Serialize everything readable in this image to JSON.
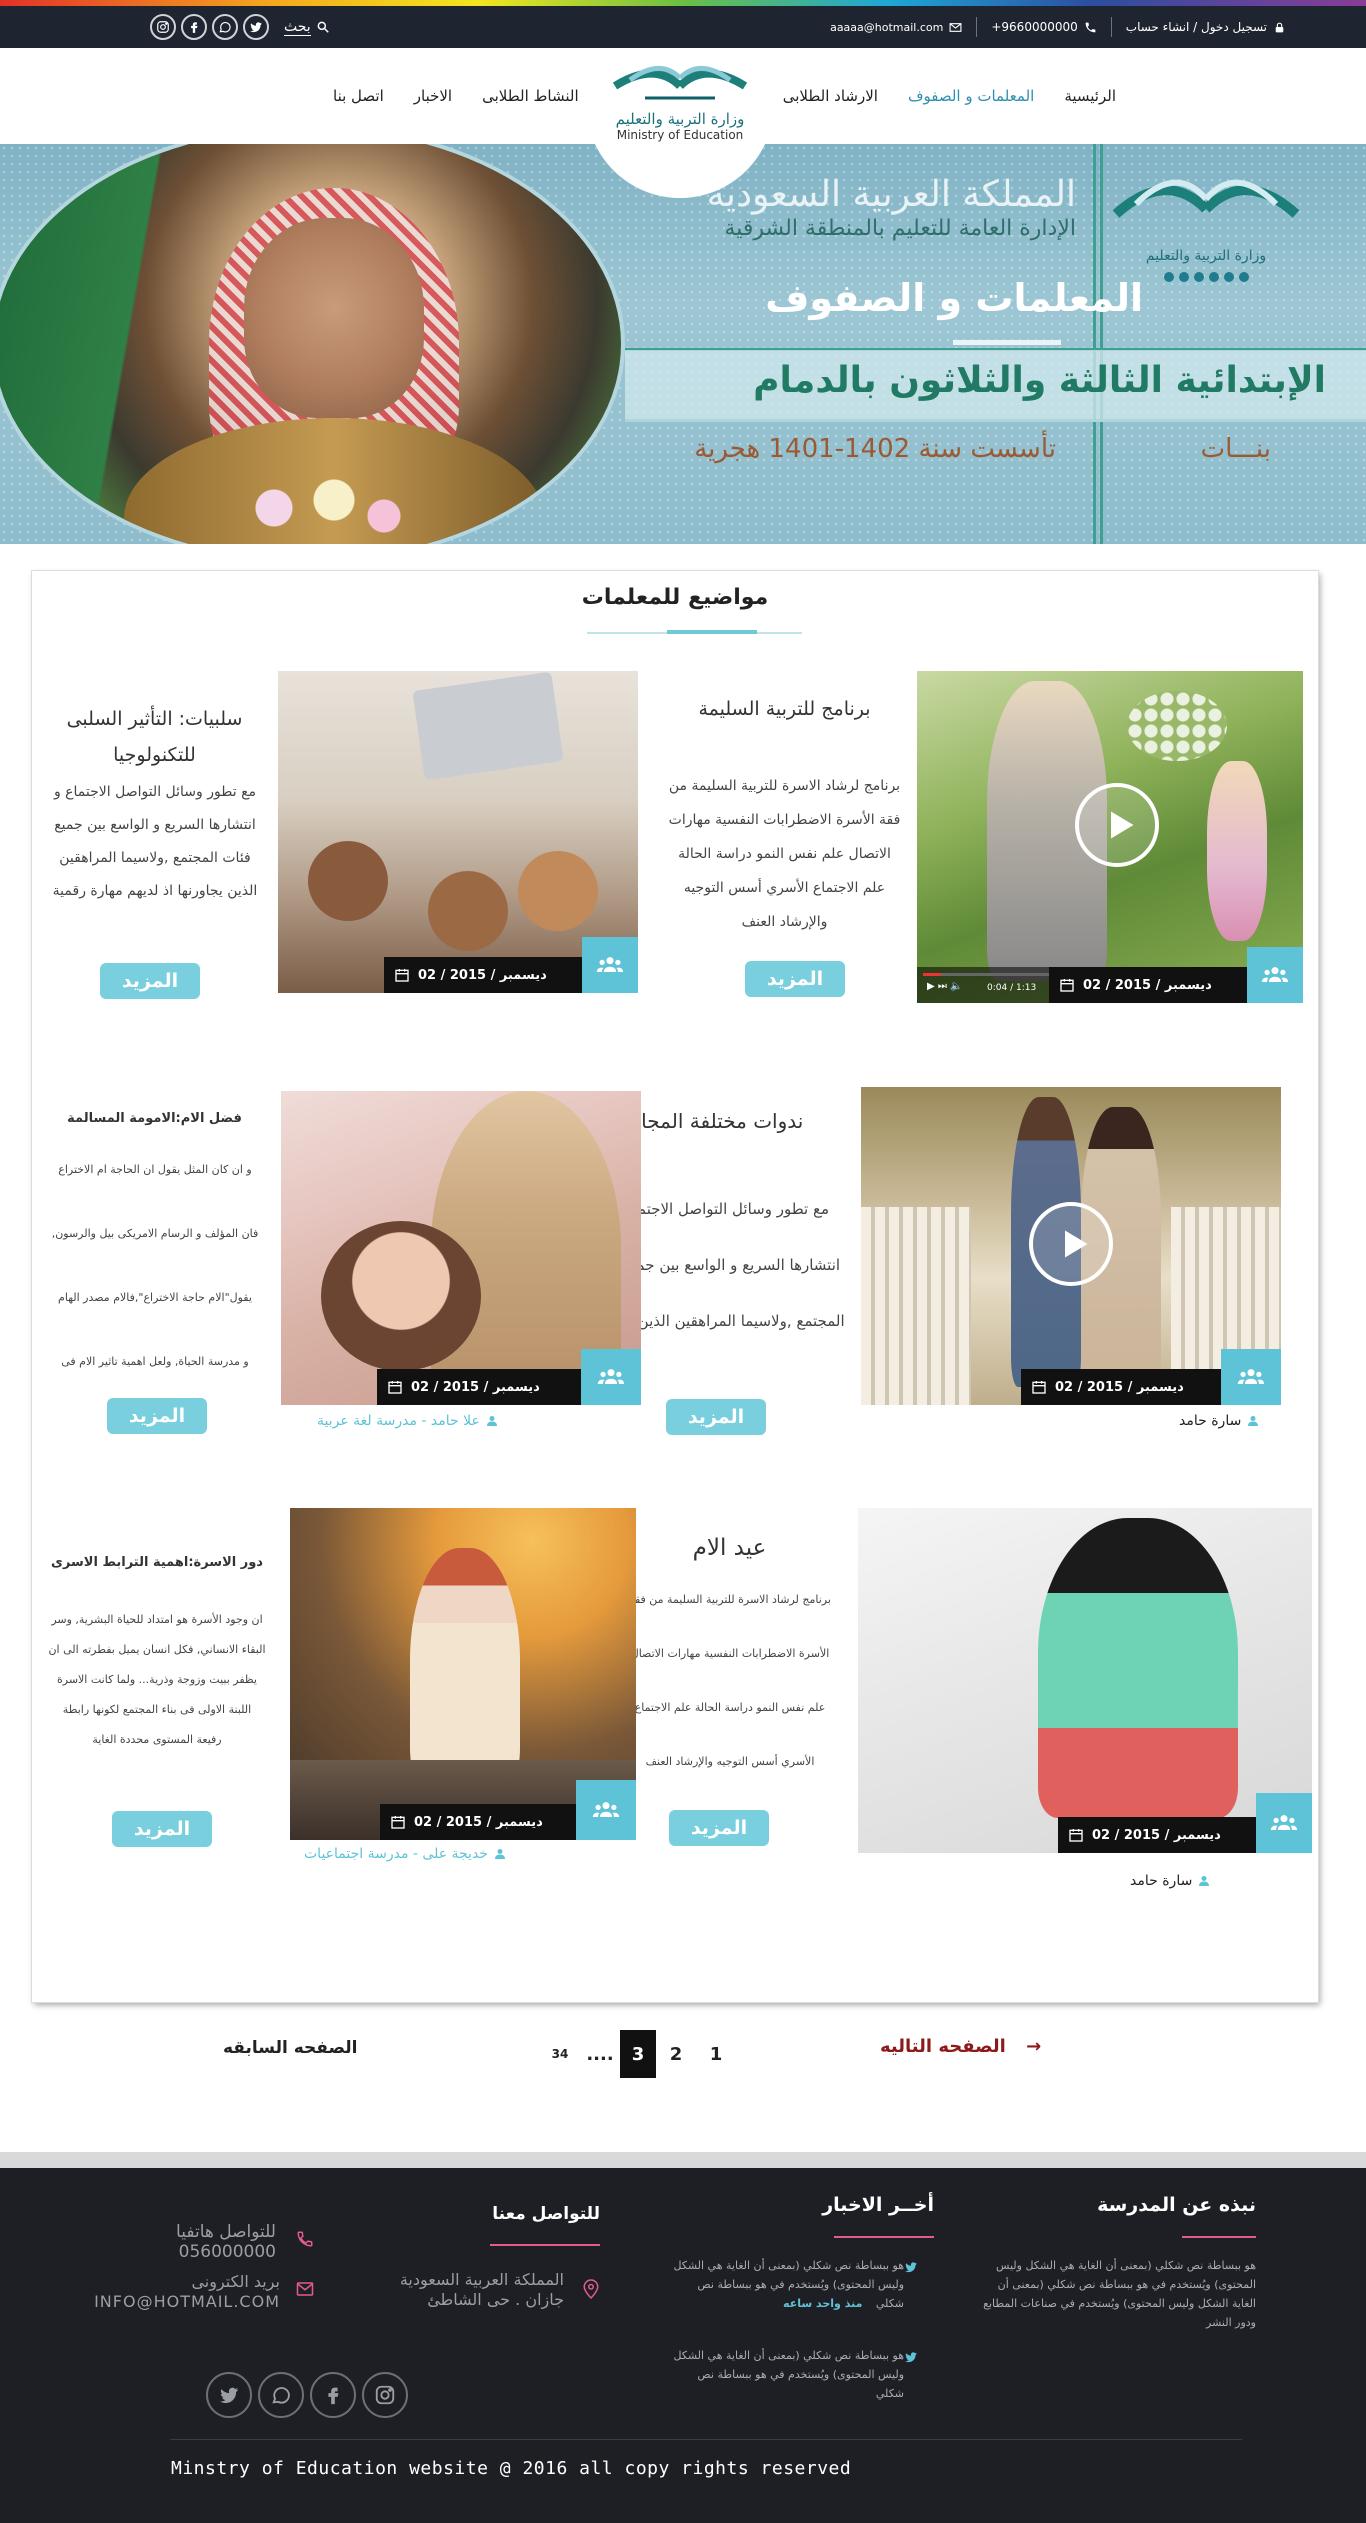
{
  "topbar": {
    "search_label": "بحث",
    "login_label": "تسجيل دخول / انشاء حساب",
    "phone": "+9660000000",
    "email": "aaaaa@hotmail.com"
  },
  "nav": {
    "items": [
      "الرئيسية",
      "المعلمات و الصفوف",
      "الارشاد الطلابى",
      "النشاط الطلابى",
      "الاخبار",
      "اتصل بنا"
    ],
    "active_index": 1,
    "logo_ar": "وزارة التربية والتعليم",
    "logo_en": "Ministry of Education"
  },
  "hero": {
    "kingdom": "المملكة العربية السعودية",
    "directorate": "الإدارة العامة للتعليم بالمنطقة الشرقية",
    "page_title": "المعلمات و الصفوف",
    "school": "الإبتدائية الثالثة والثلاثون بالدمام",
    "founded": "تأسست سنة 1402-1401 هجرية",
    "girls": "بنـــات",
    "mini_logo_ar": "وزارة التربية والتعليم"
  },
  "section": {
    "title": "مواضيع للمعلمات"
  },
  "posts": [
    {
      "date": "02 / ديسمبر / 2015",
      "title": "برنامج للتربية السليمة",
      "body": "برنامج لرشاد الاسرة للتربية السليمة من فقة الأسرة الاضطرابات النفسية مهارات الاتصال علم نفس النمو دراسة الحالة علم الاجتماع الأسري أسس التوجيه والإرشاد العنف",
      "more": "المزيد"
    },
    {
      "date": "02 / ديسمبر / 2015",
      "title": "سلبيات: التأثير السلبى للتكنولوجيا",
      "body": "مع تطور وسائل التواصل الاجتماع و انتشارها السريع و الواسع بين جميع فئات المجتمع ,ولاسيما المراهقين الذين يجاورنها اذ لديهم مهارة رقمية",
      "more": "المزيد"
    },
    {
      "date": "02 / ديسمبر / 2015",
      "title": "ندوات مختلفة المجال",
      "body": "مع تطور وسائل التواصل الاجتماعى و انتشارها السريع و الواسع بين جميع فئات المجتمع ,ولاسيما المراهقين الذين يجاورنها",
      "more": "المزيد",
      "author": "سارة حامد"
    },
    {
      "date": "02 / ديسمبر / 2015",
      "title": "فضل الام:الامومة المسالمة",
      "lines": [
        "و ان كان المثل يقول ان الحاجة ام الاختراع",
        "فان المؤلف و الرسام الامريكى بيل والرسون,",
        "يقول\"الام حاجة الاختراع\",فالام مصدر الهام",
        "و مدرسة الحياة, ولعل اهمية تاثير الام فى"
      ],
      "more": "المزيد",
      "author": "علا حامد - مدرسة لغة عربية"
    },
    {
      "date": "02 / ديسمبر / 2015",
      "title": "عيد الام",
      "lines": [
        "برنامج لرشاد الاسرة للتربية السليمة من فقة",
        "الأسرة الاضطرابات النفسية مهارات الاتصال",
        "علم نفس النمو دراسة الحالة علم الاجتماع",
        "الأسري أسس التوجيه والإرشاد العنف"
      ],
      "more": "المزيد",
      "author": "سارة حامد"
    },
    {
      "date": "02 / ديسمبر / 2015",
      "title": "دور الاسرة:اهمية الترابط الاسرى",
      "lines": [
        "ان وجود الأسرة هو امتداد للحياة البشرية, وسر",
        "البقاء الانساني, فكل انسان يميل بفطرته الى ان",
        "يظفر ببيت وزوجة وذرية... ولما كانت الاسرة",
        "اللبنة الاولى فى بناء المجتمع لكونها رابطة",
        "رفيعة المستوى محددة الغاية"
      ],
      "more": "المزيد",
      "author": "خديجة على - مدرسة اجتماعيات"
    }
  ],
  "video_time": "0:04 / 1:13",
  "pagination": {
    "prev": "الصفحه السابقه",
    "next": "الصفحه التاليه",
    "pages": [
      "1",
      "2",
      "3",
      "....",
      "34"
    ],
    "current": "3",
    "next_arrow": "→"
  },
  "footer": {
    "about_title": "نبذه عن المدرسة",
    "about_text": "هو ببساطة نص شكلي (بمعنى أن الغاية هي الشكل وليس المحتوى) ويُستخدم في هو ببساطة نص شكلي (بمعنى أن الغاية الشكل وليس المحتوى) ويُستخدم في صناعات المطابع ودور النشر",
    "news_title": "أخــر الاخبار",
    "news": [
      {
        "text": "هو ببساطة نص شكلي (بمعنى أن الغاية هي الشكل وليس المحتوى) ويُستخدم في هو ببساطة نص شكلي",
        "time": "منذ واحد ساعه"
      },
      {
        "text": "هو ببساطة نص شكلي (بمعنى أن الغاية هي الشكل وليس المحتوى) ويُستخدم في هو ببساطة نص شكلي"
      }
    ],
    "contact_title": "للتواصل معنا",
    "address_1": "المملكة العربية السعودية",
    "address_2": "جازان . حى الشاطئ",
    "phone_label": "للتواصل هاتفيا",
    "phone": "056000000",
    "email_label": "بريد الكترونى",
    "email": "INFO@HOTMAIL.COM",
    "copyright": "Minstry of Education website @ 2016  all copy rights reserved"
  },
  "colors": {
    "accent": "#79cfdd",
    "dark": "#1f2530",
    "footer_bg": "#1e1f24",
    "nav_active": "#2f8fb0",
    "next_link": "#8b1a1a"
  }
}
